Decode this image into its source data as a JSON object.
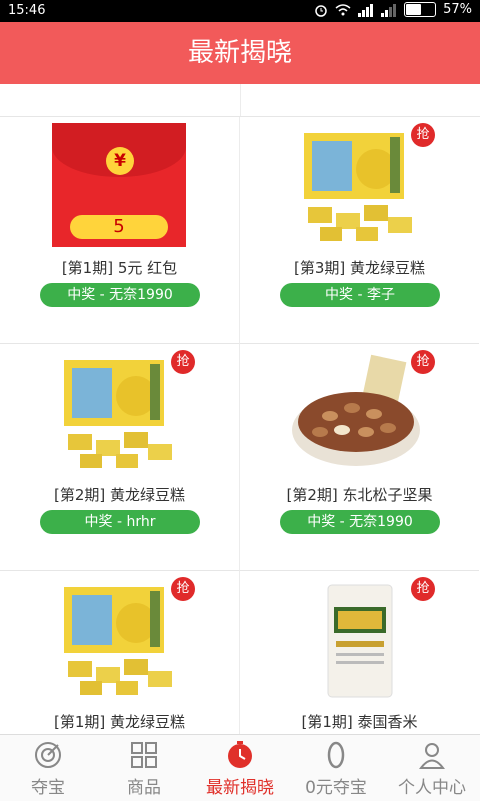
{
  "status_bar": {
    "time": "15:46",
    "battery": "57%",
    "battery_level": 0.57
  },
  "header": {
    "title": "最新揭晓"
  },
  "colors": {
    "accent": "#f25a5a",
    "winner_badge": "#3cb04a",
    "badge": "#e02a2a"
  },
  "items": [
    {
      "title": "[第1期] 5元    红包",
      "winner": "中奖 - 无奈1990",
      "image": "red-envelope-image",
      "badge": "",
      "amount": "5"
    },
    {
      "title": "[第3期] 黄龙绿豆糕",
      "winner": "中奖 - 李子",
      "image": "mung-bean-cake-image",
      "badge": "抢"
    },
    {
      "title": "[第2期] 黄龙绿豆糕",
      "winner": "中奖 - hrhr",
      "image": "mung-bean-cake-image",
      "badge": "抢"
    },
    {
      "title": "[第2期] 东北松子坚果",
      "winner": "中奖 - 无奈1990",
      "image": "pine-nuts-image",
      "badge": "抢"
    },
    {
      "title": "[第1期] 黄龙绿豆糕",
      "winner": "",
      "image": "mung-bean-cake-image",
      "badge": "抢"
    },
    {
      "title": "[第1期] 泰国香米",
      "winner": "",
      "image": "rice-bag-image",
      "badge": "抢"
    }
  ],
  "tabs": [
    {
      "label": "夺宝",
      "icon": "target-icon"
    },
    {
      "label": "商品",
      "icon": "grid-icon"
    },
    {
      "label": "最新揭晓",
      "icon": "clock-icon",
      "active": true
    },
    {
      "label": "0元夺宝",
      "icon": "zero-icon"
    },
    {
      "label": "个人中心",
      "icon": "person-icon"
    }
  ]
}
